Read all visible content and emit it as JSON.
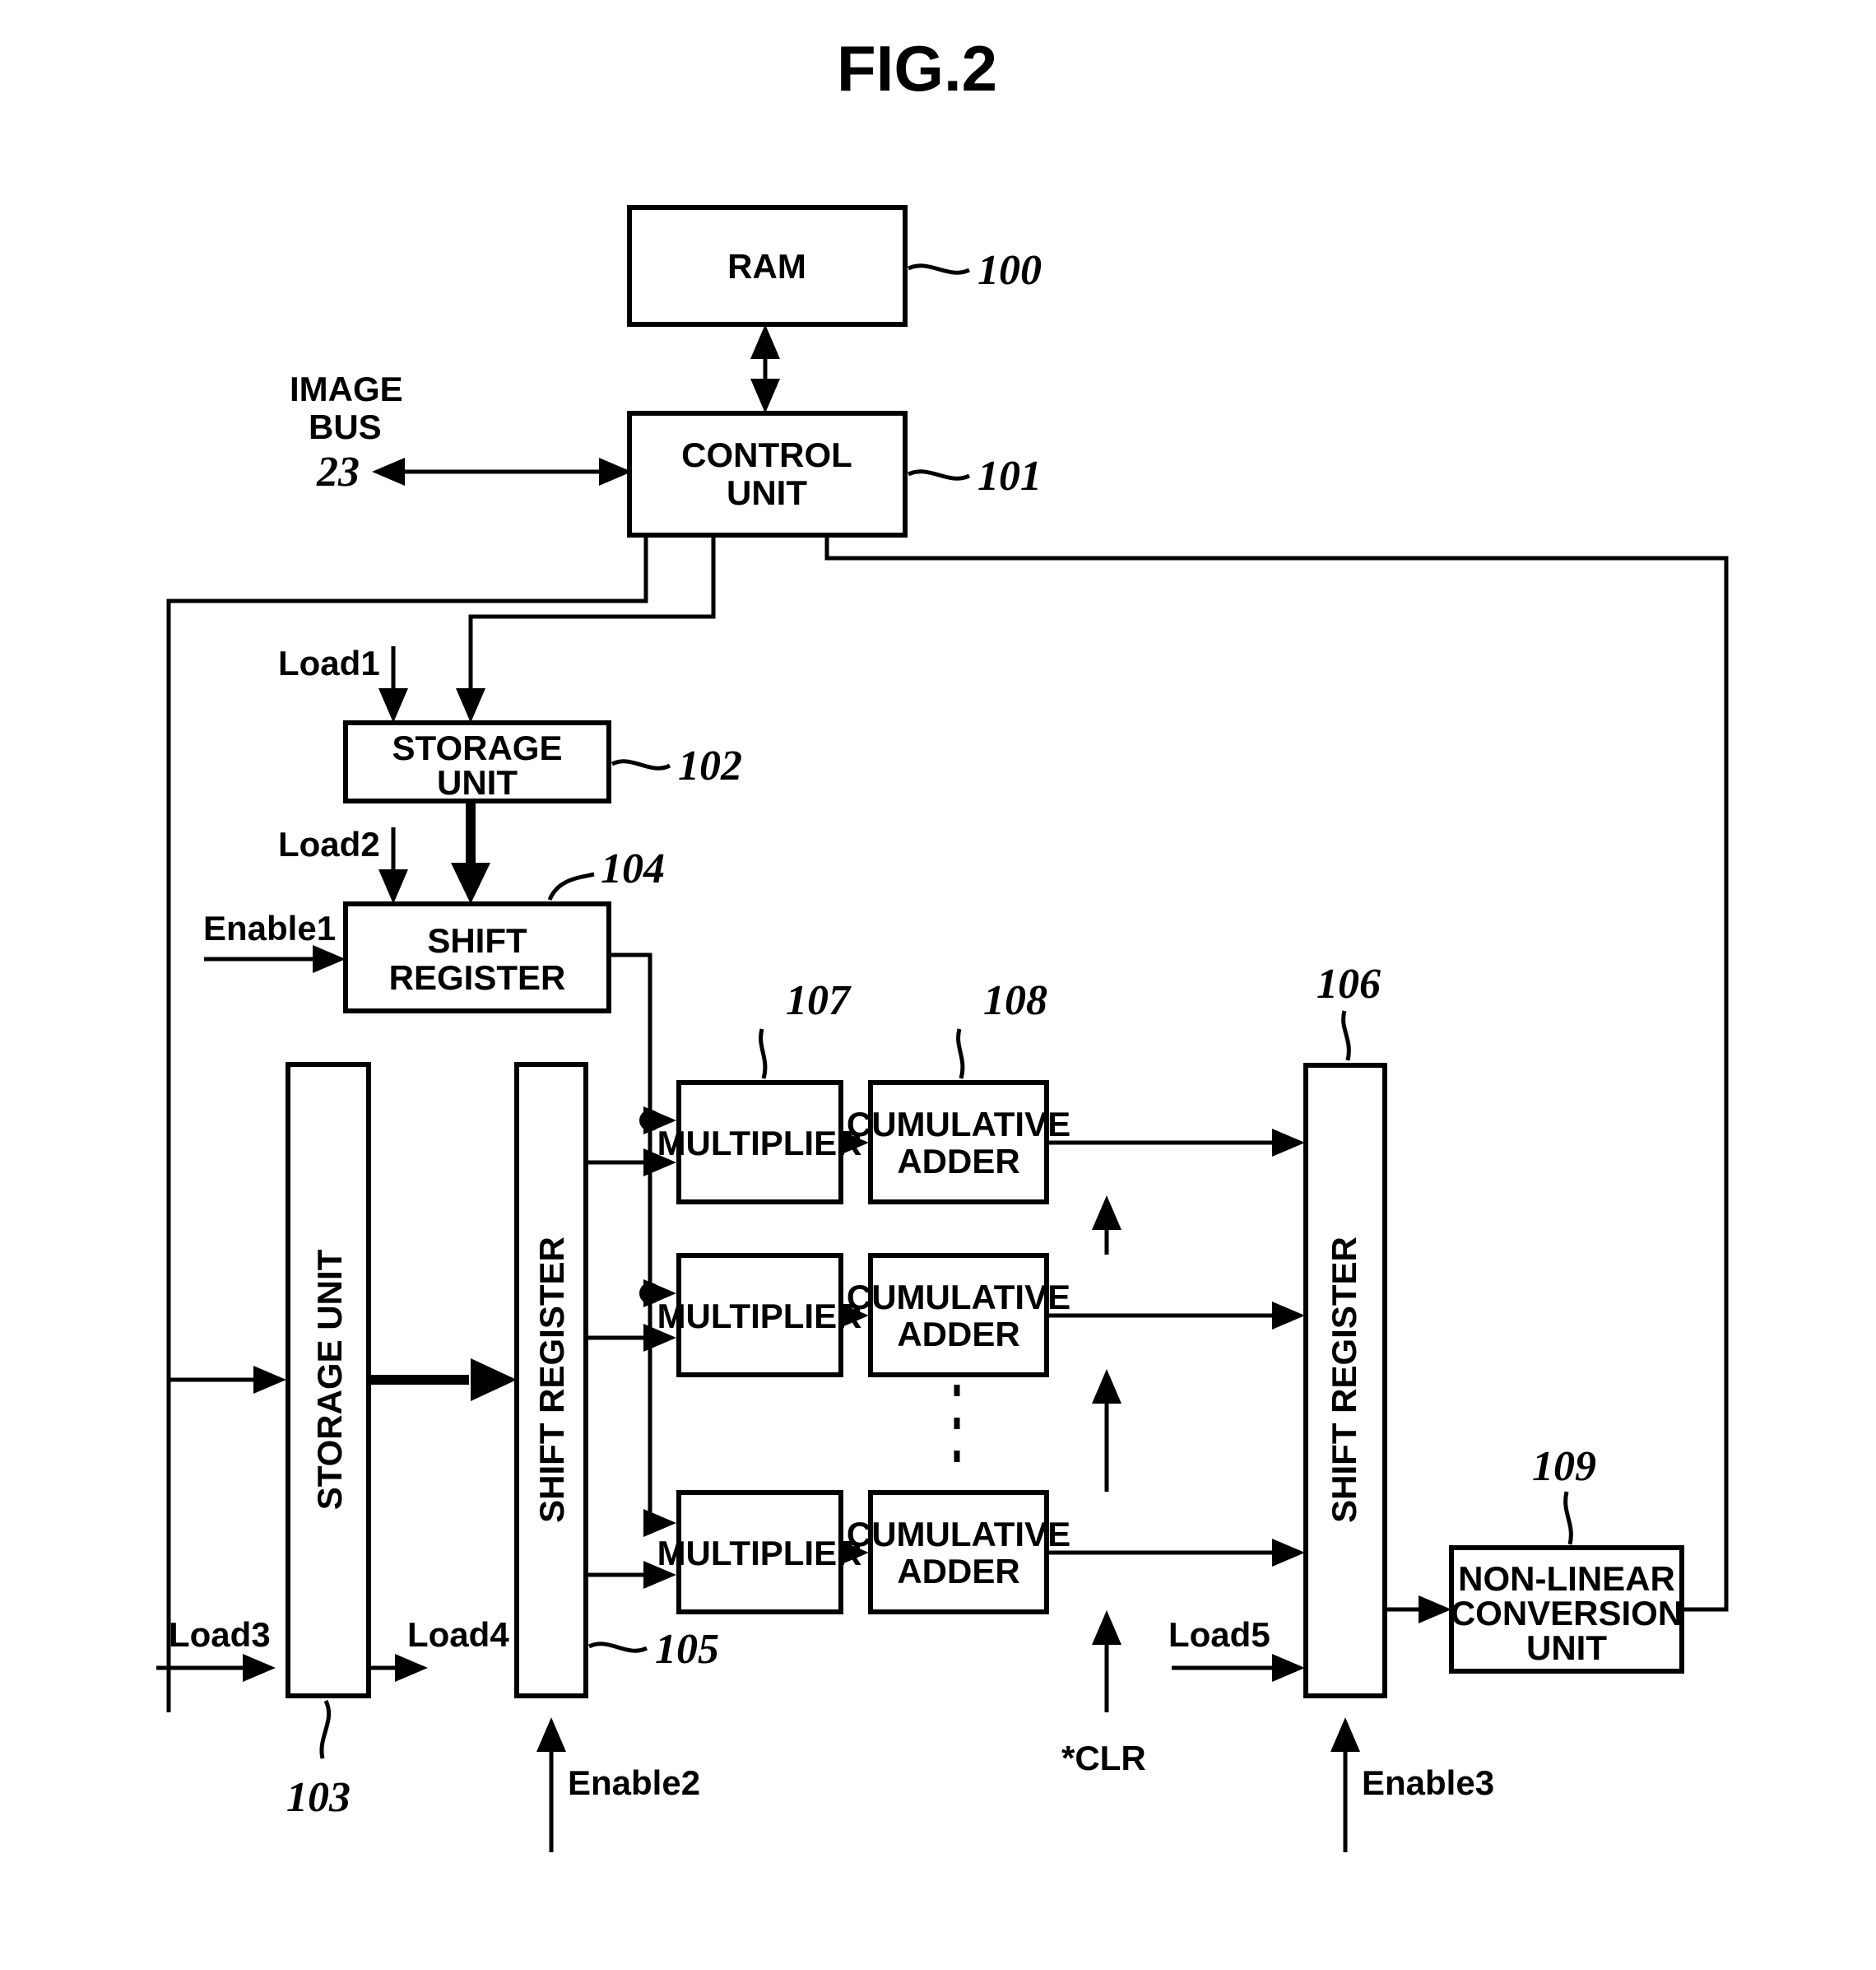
{
  "figure": {
    "title": "FIG.2",
    "type": "patent-block-diagram"
  },
  "blocks": [
    {
      "id": "ram",
      "label": "RAM",
      "ref": "100"
    },
    {
      "id": "control",
      "label_1": "CONTROL",
      "label_2": "UNIT",
      "ref": "101"
    },
    {
      "id": "storage102",
      "label_1": "STORAGE",
      "label_2": "UNIT",
      "ref": "102"
    },
    {
      "id": "shift104",
      "label_1": "SHIFT",
      "label_2": "REGISTER",
      "ref": "104"
    },
    {
      "id": "storage103",
      "label": "STORAGE UNIT",
      "ref": "103"
    },
    {
      "id": "shift105",
      "label": "SHIFT REGISTER",
      "ref": "105"
    },
    {
      "id": "shift106",
      "label": "SHIFT REGISTER",
      "ref": "106"
    },
    {
      "id": "mult1",
      "label": "MULTIPLIER",
      "ref": "107"
    },
    {
      "id": "mult2",
      "label": "MULTIPLIER",
      "ref": ""
    },
    {
      "id": "mult3",
      "label": "MULTIPLIER",
      "ref": ""
    },
    {
      "id": "adder1",
      "label_1": "CUMULATIVE",
      "label_2": "ADDER",
      "ref": "108"
    },
    {
      "id": "adder2",
      "label_1": "CUMULATIVE",
      "label_2": "ADDER",
      "ref": ""
    },
    {
      "id": "adder3",
      "label_1": "CUMULATIVE",
      "label_2": "ADDER",
      "ref": ""
    },
    {
      "id": "nonlinear",
      "label_1": "NON-LINEAR",
      "label_2": "CONVERSION",
      "label_3": "UNIT",
      "ref": "109"
    }
  ],
  "labels": {
    "image_bus_line1": "IMAGE",
    "image_bus_line2": "BUS",
    "image_bus_ref": "23",
    "load1": "Load1",
    "load2": "Load2",
    "load3": "Load3",
    "load4": "Load4",
    "load5": "Load5",
    "enable1": "Enable1",
    "enable2": "Enable2",
    "enable3": "Enable3",
    "clr": "*CLR"
  },
  "refs": {
    "r100": "100",
    "r101": "101",
    "r102": "102",
    "r103": "103",
    "r104": "104",
    "r105": "105",
    "r106": "106",
    "r107": "107",
    "r108": "108",
    "r109": "109"
  },
  "colors": {
    "ink": "#000000",
    "paper": "#ffffff"
  }
}
